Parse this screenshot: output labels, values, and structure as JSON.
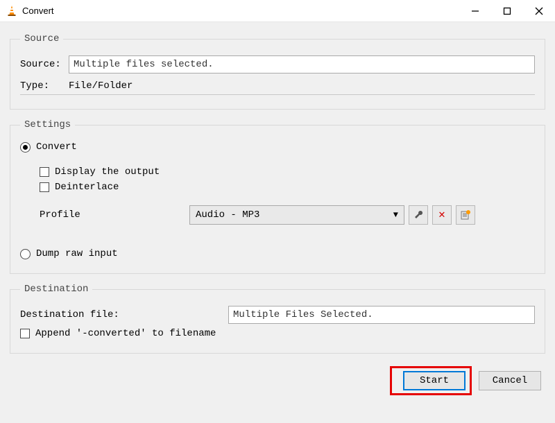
{
  "title": "Convert",
  "source_section": {
    "legend": "Source",
    "source_label": "Source:",
    "source_value": "Multiple files selected.",
    "type_label": "Type:",
    "type_value": "File/Folder"
  },
  "settings_section": {
    "legend": "Settings",
    "convert_label": "Convert",
    "display_output_label": "Display the output",
    "deinterlace_label": "Deinterlace",
    "profile_label": "Profile",
    "profile_selected": "Audio - MP3",
    "dump_raw_label": "Dump raw input"
  },
  "destination_section": {
    "legend": "Destination",
    "file_label": "Destination file:",
    "file_value": "Multiple Files Selected.",
    "append_label": "Append '-converted' to filename"
  },
  "buttons": {
    "start": "Start",
    "cancel": "Cancel"
  }
}
